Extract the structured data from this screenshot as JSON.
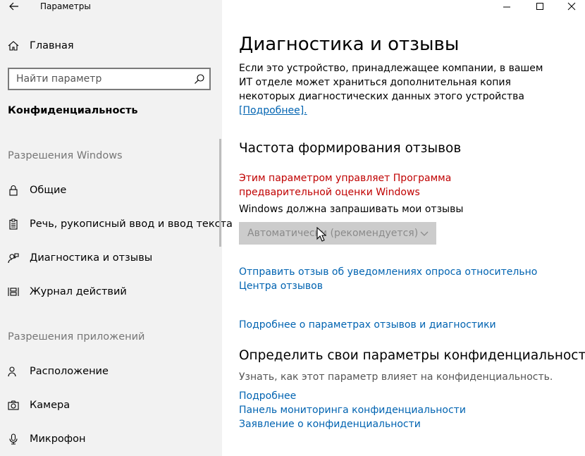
{
  "window": {
    "title": "Параметры"
  },
  "sidebar": {
    "home_label": "Главная",
    "search_placeholder": "Найти параметр",
    "section_title": "Конфиденциальность",
    "group_windows": "Разрешения Windows",
    "group_apps": "Разрешения приложений",
    "items": [
      {
        "label": "Общие",
        "icon": "lock-icon"
      },
      {
        "label": "Речь, рукописный ввод и ввод текста",
        "icon": "clipboard-icon"
      },
      {
        "label": "Диагностика и отзывы",
        "icon": "person-feedback-icon"
      },
      {
        "label": "Журнал действий",
        "icon": "activity-icon"
      },
      {
        "label": "Расположение",
        "icon": "location-person-icon"
      },
      {
        "label": "Камера",
        "icon": "camera-icon"
      },
      {
        "label": "Микрофон",
        "icon": "microphone-icon"
      }
    ]
  },
  "main": {
    "title": "Диагностика и отзывы",
    "description": "Если это устройство, принадлежащее компании, в вашем ИТ отделе может храниться дополнительная копия некоторых диагностических данных этого устройства",
    "description_link": "[Подробнее].",
    "feedback_heading": "Частота формирования отзывов",
    "managed_warning": "Этим параметром управляет Программа предварительной оценки Windows",
    "ask_label": "Windows должна запрашивать мои отзывы",
    "dropdown_value": "Автоматически (рекомендуется)",
    "link_feedback_line1": "Отправить отзыв об уведомлениях опроса относительно",
    "link_feedback_line2": "Центра отзывов",
    "link_more_feedback": "Подробнее о параметрах отзывов и диагностики",
    "privacy_heading": "Определить свои параметры конфиденциальности",
    "privacy_desc": "Узнать, как этот параметр влияет на конфиденциальность.",
    "link_more": "Подробнее",
    "link_dashboard": "Панель мониторинга конфиденциальности",
    "link_statement": "Заявление о конфиденциальности"
  },
  "colors": {
    "link": "#0063b1",
    "warning": "#c00000",
    "sidebar_bg": "#f2f2f2"
  }
}
